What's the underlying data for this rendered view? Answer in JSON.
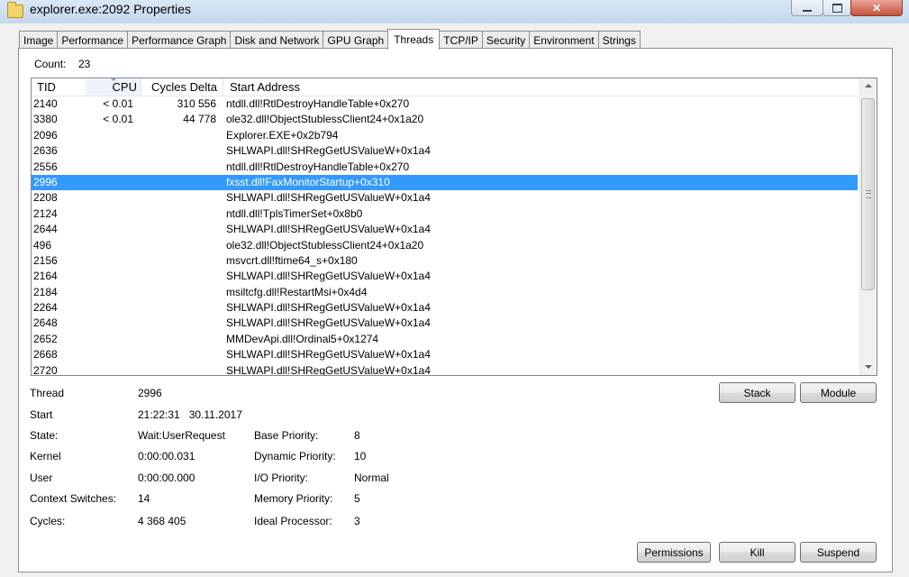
{
  "window": {
    "title": "explorer.exe:2092 Properties",
    "controls": {
      "close": "✕"
    }
  },
  "tabs": [
    {
      "label": "Image"
    },
    {
      "label": "Performance"
    },
    {
      "label": "Performance Graph"
    },
    {
      "label": "Disk and Network"
    },
    {
      "label": "GPU Graph"
    },
    {
      "label": "Threads",
      "active": true
    },
    {
      "label": "TCP/IP"
    },
    {
      "label": "Security"
    },
    {
      "label": "Environment"
    },
    {
      "label": "Strings"
    }
  ],
  "count": {
    "label": "Count:",
    "value": "23"
  },
  "table": {
    "headers": {
      "tid": "TID",
      "cpu": "CPU",
      "cycles": "Cycles Delta",
      "address": "Start Address"
    },
    "sorted_column": "cpu",
    "rows": [
      {
        "tid": "2140",
        "cpu": "< 0.01",
        "cycles": "310 556",
        "address": "ntdll.dll!RtlDestroyHandleTable+0x270"
      },
      {
        "tid": "3380",
        "cpu": "< 0.01",
        "cycles": "44 778",
        "address": "ole32.dll!ObjectStublessClient24+0x1a20"
      },
      {
        "tid": "2096",
        "cpu": "",
        "cycles": "",
        "address": "Explorer.EXE+0x2b794"
      },
      {
        "tid": "2636",
        "cpu": "",
        "cycles": "",
        "address": "SHLWAPI.dll!SHRegGetUSValueW+0x1a4"
      },
      {
        "tid": "2556",
        "cpu": "",
        "cycles": "",
        "address": "ntdll.dll!RtlDestroyHandleTable+0x270"
      },
      {
        "tid": "2996",
        "cpu": "",
        "cycles": "",
        "address": "fxsst.dll!FaxMonitorStartup+0x310",
        "selected": true
      },
      {
        "tid": "2208",
        "cpu": "",
        "cycles": "",
        "address": "SHLWAPI.dll!SHRegGetUSValueW+0x1a4"
      },
      {
        "tid": "2124",
        "cpu": "",
        "cycles": "",
        "address": "ntdll.dll!TplsTimerSet+0x8b0"
      },
      {
        "tid": "2644",
        "cpu": "",
        "cycles": "",
        "address": "SHLWAPI.dll!SHRegGetUSValueW+0x1a4"
      },
      {
        "tid": "496",
        "cpu": "",
        "cycles": "",
        "address": "ole32.dll!ObjectStublessClient24+0x1a20"
      },
      {
        "tid": "2156",
        "cpu": "",
        "cycles": "",
        "address": "msvcrt.dll!ftime64_s+0x180"
      },
      {
        "tid": "2164",
        "cpu": "",
        "cycles": "",
        "address": "SHLWAPI.dll!SHRegGetUSValueW+0x1a4"
      },
      {
        "tid": "2184",
        "cpu": "",
        "cycles": "",
        "address": "msiltcfg.dll!RestartMsi+0x4d4"
      },
      {
        "tid": "2264",
        "cpu": "",
        "cycles": "",
        "address": "SHLWAPI.dll!SHRegGetUSValueW+0x1a4"
      },
      {
        "tid": "2648",
        "cpu": "",
        "cycles": "",
        "address": "SHLWAPI.dll!SHRegGetUSValueW+0x1a4"
      },
      {
        "tid": "2652",
        "cpu": "",
        "cycles": "",
        "address": "MMDevApi.dll!Ordinal5+0x1274"
      },
      {
        "tid": "2668",
        "cpu": "",
        "cycles": "",
        "address": "SHLWAPI.dll!SHRegGetUSValueW+0x1a4"
      },
      {
        "tid": "2720",
        "cpu": "",
        "cycles": "",
        "address": "SHLWAPI.dll!SHRegGetUSValueW+0x1a4"
      }
    ]
  },
  "details": {
    "thread": {
      "label": "Thread",
      "value": "2996"
    },
    "start": {
      "label": "Start",
      "value": "21:22:31   30.11.2017"
    },
    "state": {
      "label": "State:",
      "value": "Wait:UserRequest"
    },
    "kernel": {
      "label": "Kernel",
      "value": "0:00:00.031"
    },
    "user": {
      "label": "User",
      "value": "0:00:00.000"
    },
    "context_switches": {
      "label": "Context Switches:",
      "value": "14"
    },
    "cycles": {
      "label": "Cycles:",
      "value": "4 368 405"
    },
    "base_priority": {
      "label": "Base Priority:",
      "value": "8"
    },
    "dynamic_priority": {
      "label": "Dynamic Priority:",
      "value": "10"
    },
    "io_priority": {
      "label": "I/O Priority:",
      "value": "Normal"
    },
    "memory_priority": {
      "label": "Memory Priority:",
      "value": "5"
    },
    "ideal_processor": {
      "label": "Ideal Processor:",
      "value": "3"
    }
  },
  "buttons": {
    "stack": "Stack",
    "module": "Module",
    "permissions": "Permissions",
    "kill": "Kill",
    "suspend": "Suspend"
  },
  "colors": {
    "selection": "#3399ff",
    "title_bar": "#c4d7ec",
    "close_button": "#c7533d"
  }
}
